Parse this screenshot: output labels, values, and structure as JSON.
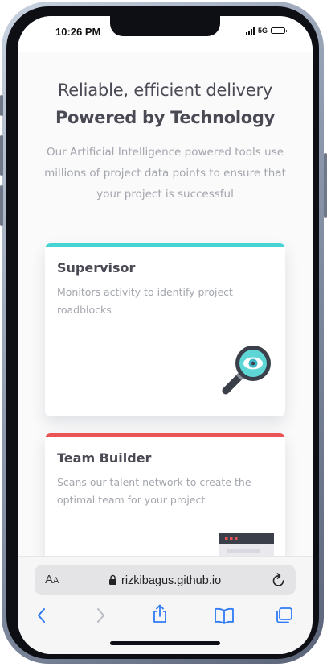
{
  "status_bar": {
    "time": "10:26 PM",
    "network": "5G"
  },
  "header": {
    "title_light": "Reliable, efficient delivery",
    "title_bold": "Powered by Technology",
    "description": "Our Artificial Intelligence powered tools use millions of project data points to ensure that your project is successful"
  },
  "cards": [
    {
      "title": "Supervisor",
      "description": "Monitors activity to identify project roadblocks",
      "accent": "#45d3d3",
      "icon": "supervisor-icon"
    },
    {
      "title": "Team Builder",
      "description": "Scans our talent network to create the optimal team for your project",
      "accent": "#ea5454",
      "icon": "team-builder-icon"
    }
  ],
  "browser": {
    "text_size_label": "AA",
    "url": "rizkibagus.github.io",
    "toolbar": [
      "back",
      "forward",
      "share",
      "bookmarks",
      "tabs"
    ]
  },
  "colors": {
    "heading": "#4a4a55",
    "body_text": "#a4a6ae",
    "cyan": "#45d3d3",
    "red": "#ea5454",
    "link_blue": "#2f7bf6"
  }
}
